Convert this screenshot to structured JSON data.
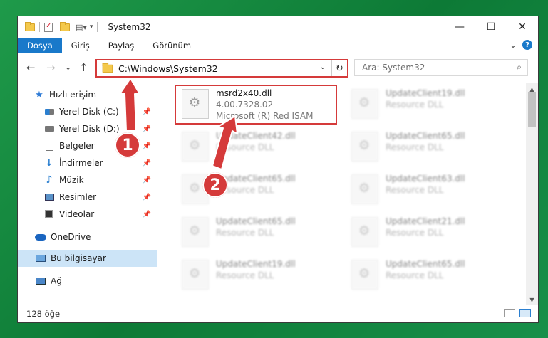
{
  "window": {
    "title": "System32",
    "controls": {
      "minimize": "—",
      "maximize": "☐",
      "close": "✕"
    }
  },
  "ribbon": {
    "tabs": [
      "Dosya",
      "Giriş",
      "Paylaş",
      "Görünüm"
    ],
    "expand": "⌄",
    "help": "?"
  },
  "address": {
    "back": "←",
    "forward": "→",
    "recent": "⌄",
    "up": "↑",
    "path": "C:\\Windows\\System32",
    "dropdown": "⌄",
    "refresh": "↻"
  },
  "search": {
    "placeholder": "Ara: System32",
    "icon": "magnifier-icon"
  },
  "sidebar": {
    "items": [
      {
        "label": "Hızlı erişim",
        "icon": "star-icon",
        "pinned": false
      },
      {
        "label": "Yerel Disk (C:)",
        "icon": "drive-icon",
        "pinned": true
      },
      {
        "label": "Yerel Disk (D:)",
        "icon": "drive-icon",
        "pinned": true
      },
      {
        "label": "Belgeler",
        "icon": "document-icon",
        "pinned": true
      },
      {
        "label": "İndirmeler",
        "icon": "download-icon",
        "pinned": true
      },
      {
        "label": "Müzik",
        "icon": "music-icon",
        "pinned": true
      },
      {
        "label": "Resimler",
        "icon": "pictures-icon",
        "pinned": true
      },
      {
        "label": "Videolar",
        "icon": "video-icon",
        "pinned": true
      },
      {
        "label": "OneDrive",
        "icon": "cloud-icon",
        "pinned": false
      },
      {
        "label": "Bu bilgisayar",
        "icon": "computer-icon",
        "pinned": false,
        "selected": true
      },
      {
        "label": "Ağ",
        "icon": "network-icon",
        "pinned": false
      }
    ]
  },
  "files": [
    {
      "name": "msrd2x40.dll",
      "version": "4.00.7328.02",
      "description": "Microsoft (R) Red ISAM",
      "highlighted": true
    },
    {
      "name": "UpdateClient19.dll",
      "description": "Resource DLL"
    },
    {
      "name": "UpdateClient42.dll",
      "description": "Resource DLL"
    },
    {
      "name": "UpdateClient65.dll",
      "description": "Resource DLL"
    },
    {
      "name": "UpdateClient65.dll",
      "description": "Resource DLL"
    },
    {
      "name": "UpdateClient63.dll",
      "description": "Resource DLL"
    },
    {
      "name": "UpdateClient65.dll",
      "description": "Resource DLL"
    },
    {
      "name": "UpdateClient21.dll",
      "description": "Resource DLL"
    },
    {
      "name": "UpdateClient19.dll",
      "description": "Resource DLL"
    },
    {
      "name": "UpdateClient65.dll",
      "description": "Resource DLL"
    }
  ],
  "status": {
    "item_count": "128 öğe"
  },
  "annotations": {
    "step1": "1",
    "step2": "2",
    "color": "#d53a3a"
  }
}
